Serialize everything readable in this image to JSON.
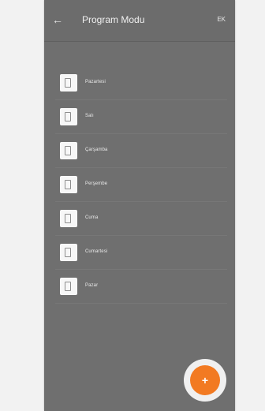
{
  "header": {
    "title": "Program Modu",
    "back_icon": "arrow-left-icon",
    "action_text": "EK"
  },
  "list": {
    "items": [
      {
        "label": "Pazartesi",
        "icon": "document-icon"
      },
      {
        "label": "Salı",
        "icon": "document-icon"
      },
      {
        "label": "Çarşamba",
        "icon": "document-icon"
      },
      {
        "label": "Perşembe",
        "icon": "document-icon"
      },
      {
        "label": "Cuma",
        "icon": "document-icon"
      },
      {
        "label": "Cumartesi",
        "icon": "document-icon"
      },
      {
        "label": "Pazar",
        "icon": "document-icon"
      }
    ]
  },
  "fab": {
    "label": "+",
    "icon": "plus-icon",
    "accent": "#f27a22"
  }
}
